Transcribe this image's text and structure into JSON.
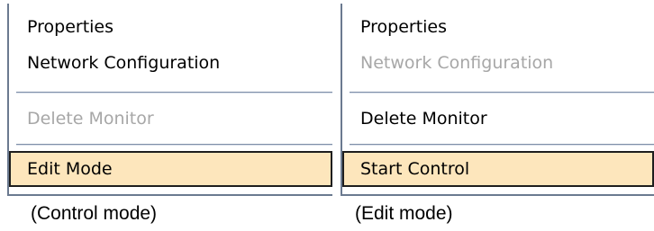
{
  "panels": {
    "control_mode": {
      "caption": "(Control mode)",
      "items": [
        {
          "label": "Properties",
          "enabled": true
        },
        {
          "label": "Network Configuration",
          "enabled": true
        },
        {
          "label": "Delete  Monitor",
          "enabled": false
        },
        {
          "label": "Edit Mode",
          "enabled": true,
          "highlighted": true
        }
      ]
    },
    "edit_mode": {
      "caption": "(Edit mode)",
      "items": [
        {
          "label": "Properties",
          "enabled": true
        },
        {
          "label": "Network Configuration",
          "enabled": false
        },
        {
          "label": "Delete  Monitor",
          "enabled": true
        },
        {
          "label": "Start Control",
          "enabled": true,
          "highlighted": true
        }
      ]
    }
  },
  "colors": {
    "highlight_background": "#fde6bc",
    "disabled_text": "#a7a7a7",
    "separator": "#7e8fa8"
  }
}
